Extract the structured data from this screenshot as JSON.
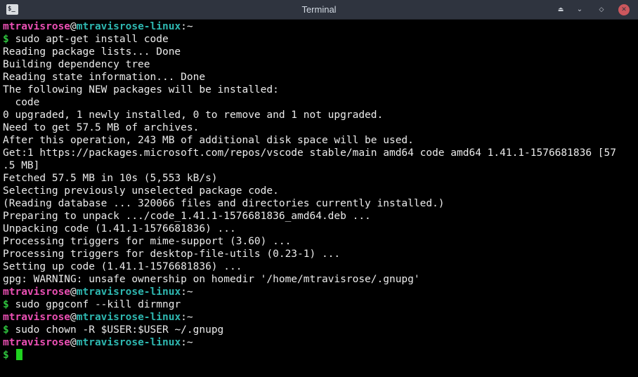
{
  "window": {
    "title": "Terminal",
    "icon_label": "$_",
    "controls": {
      "keep_above": "⏏",
      "minimize": "⌄",
      "maximize": "◇",
      "close": "✕"
    }
  },
  "prompt": {
    "user": "mtravisrose",
    "at": "@",
    "host": "mtravisrose-linux",
    "path": ":~",
    "symbol": "$"
  },
  "output": {
    "l1": "sudo apt-get install code",
    "l2": "Reading package lists... Done",
    "l3": "Building dependency tree",
    "l4": "Reading state information... Done",
    "l5": "The following NEW packages will be installed:",
    "l6": "  code",
    "l7": "0 upgraded, 1 newly installed, 0 to remove and 1 not upgraded.",
    "l8": "Need to get 57.5 MB of archives.",
    "l9": "After this operation, 243 MB of additional disk space will be used.",
    "l10": "Get:1 https://packages.microsoft.com/repos/vscode stable/main amd64 code amd64 1.41.1-1576681836 [57",
    "l11": ".5 MB]",
    "l12": "Fetched 57.5 MB in 10s (5,553 kB/s)",
    "l13": "Selecting previously unselected package code.",
    "l14": "(Reading database ... 320066 files and directories currently installed.)",
    "l15": "Preparing to unpack .../code_1.41.1-1576681836_amd64.deb ...",
    "l16": "Unpacking code (1.41.1-1576681836) ...",
    "l17": "Processing triggers for mime-support (3.60) ...",
    "l18": "Processing triggers for desktop-file-utils (0.23-1) ...",
    "l19": "Setting up code (1.41.1-1576681836) ...",
    "l20": "gpg: WARNING: unsafe ownership on homedir '/home/mtravisrose/.gnupg'",
    "cmd2": "sudo gpgconf --kill dirmngr",
    "cmd3": "sudo chown -R $USER:$USER ~/.gnupg"
  }
}
